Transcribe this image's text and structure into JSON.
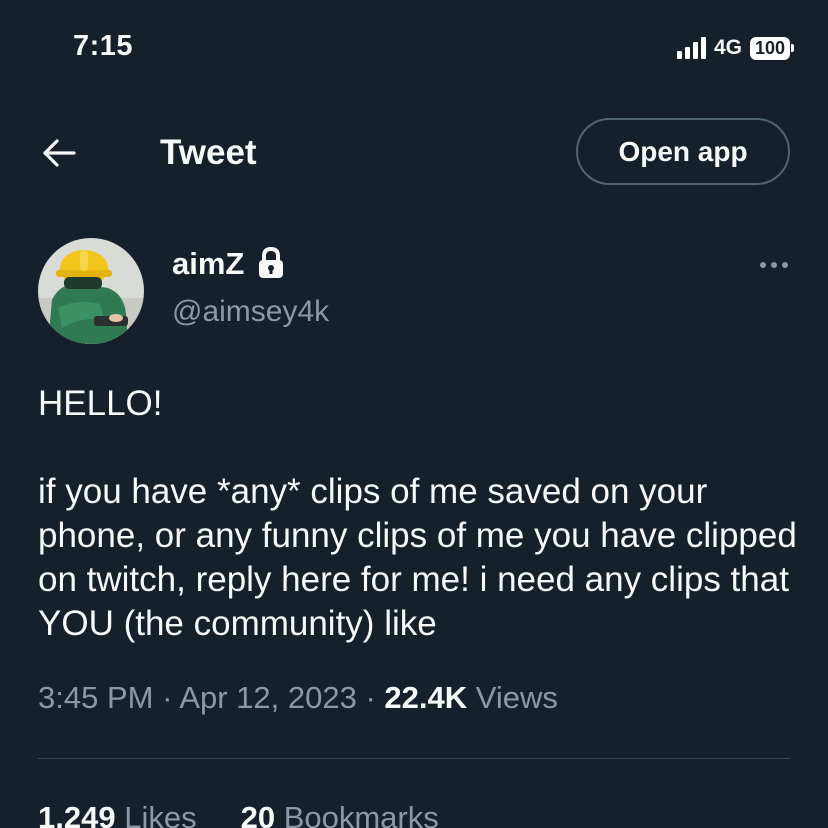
{
  "status_bar": {
    "time": "7:15",
    "network": "4G",
    "battery": "100"
  },
  "header": {
    "title": "Tweet",
    "open_app_label": "Open app"
  },
  "author": {
    "display_name": "aimZ",
    "handle": "@aimsey4k",
    "protected_icon": "lock-icon"
  },
  "tweet": {
    "line1": "HELLO!",
    "line2": "if you have *any* clips of me saved on your phone, or any funny clips of me you have clipped on twitch, reply here for me! i need any clips that YOU (the community) like"
  },
  "meta": {
    "time": "3:45 PM",
    "separator": "·",
    "date": "Apr 12, 2023",
    "views_count": "22.4K",
    "views_label": "Views"
  },
  "stats": {
    "likes_count": "1,249",
    "likes_label": "Likes",
    "bookmarks_count": "20",
    "bookmarks_label": "Bookmarks"
  },
  "colors": {
    "background": "#15202b",
    "text": "#f7f9f9",
    "secondary_text": "#8b98a5",
    "border": "#536471",
    "divider": "#38444d"
  }
}
